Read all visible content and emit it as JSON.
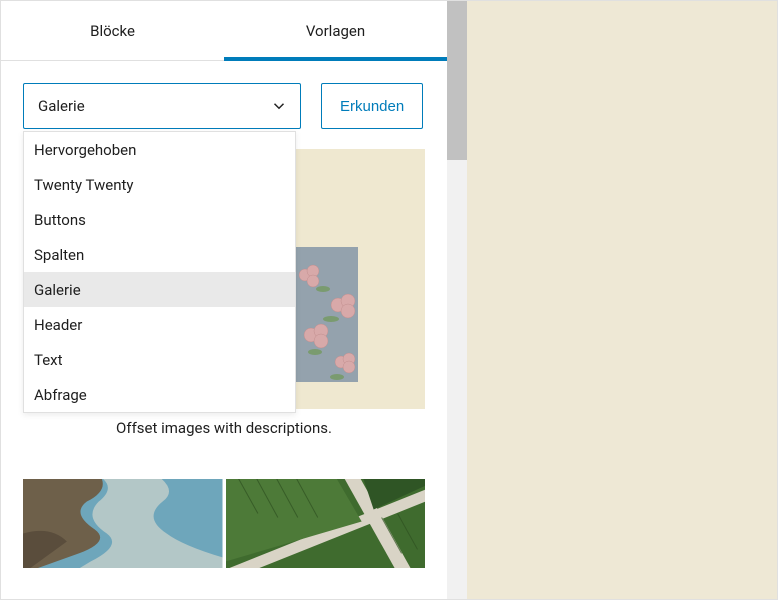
{
  "colors": {
    "accent": "#007cba",
    "preview_bg": "#eee8d5"
  },
  "tabs": {
    "items": [
      "Blöcke",
      "Vorlagen"
    ],
    "active": 1
  },
  "select": {
    "value": "Galerie",
    "options": [
      "Hervorgehoben",
      "Twenty Twenty",
      "Buttons",
      "Spalten",
      "Galerie",
      "Header",
      "Text",
      "Abfrage"
    ]
  },
  "explore": {
    "label": "Erkunden"
  },
  "pattern": {
    "caption": "Offset images with descriptions."
  },
  "scrollbar": {
    "thumb_height": 159
  }
}
